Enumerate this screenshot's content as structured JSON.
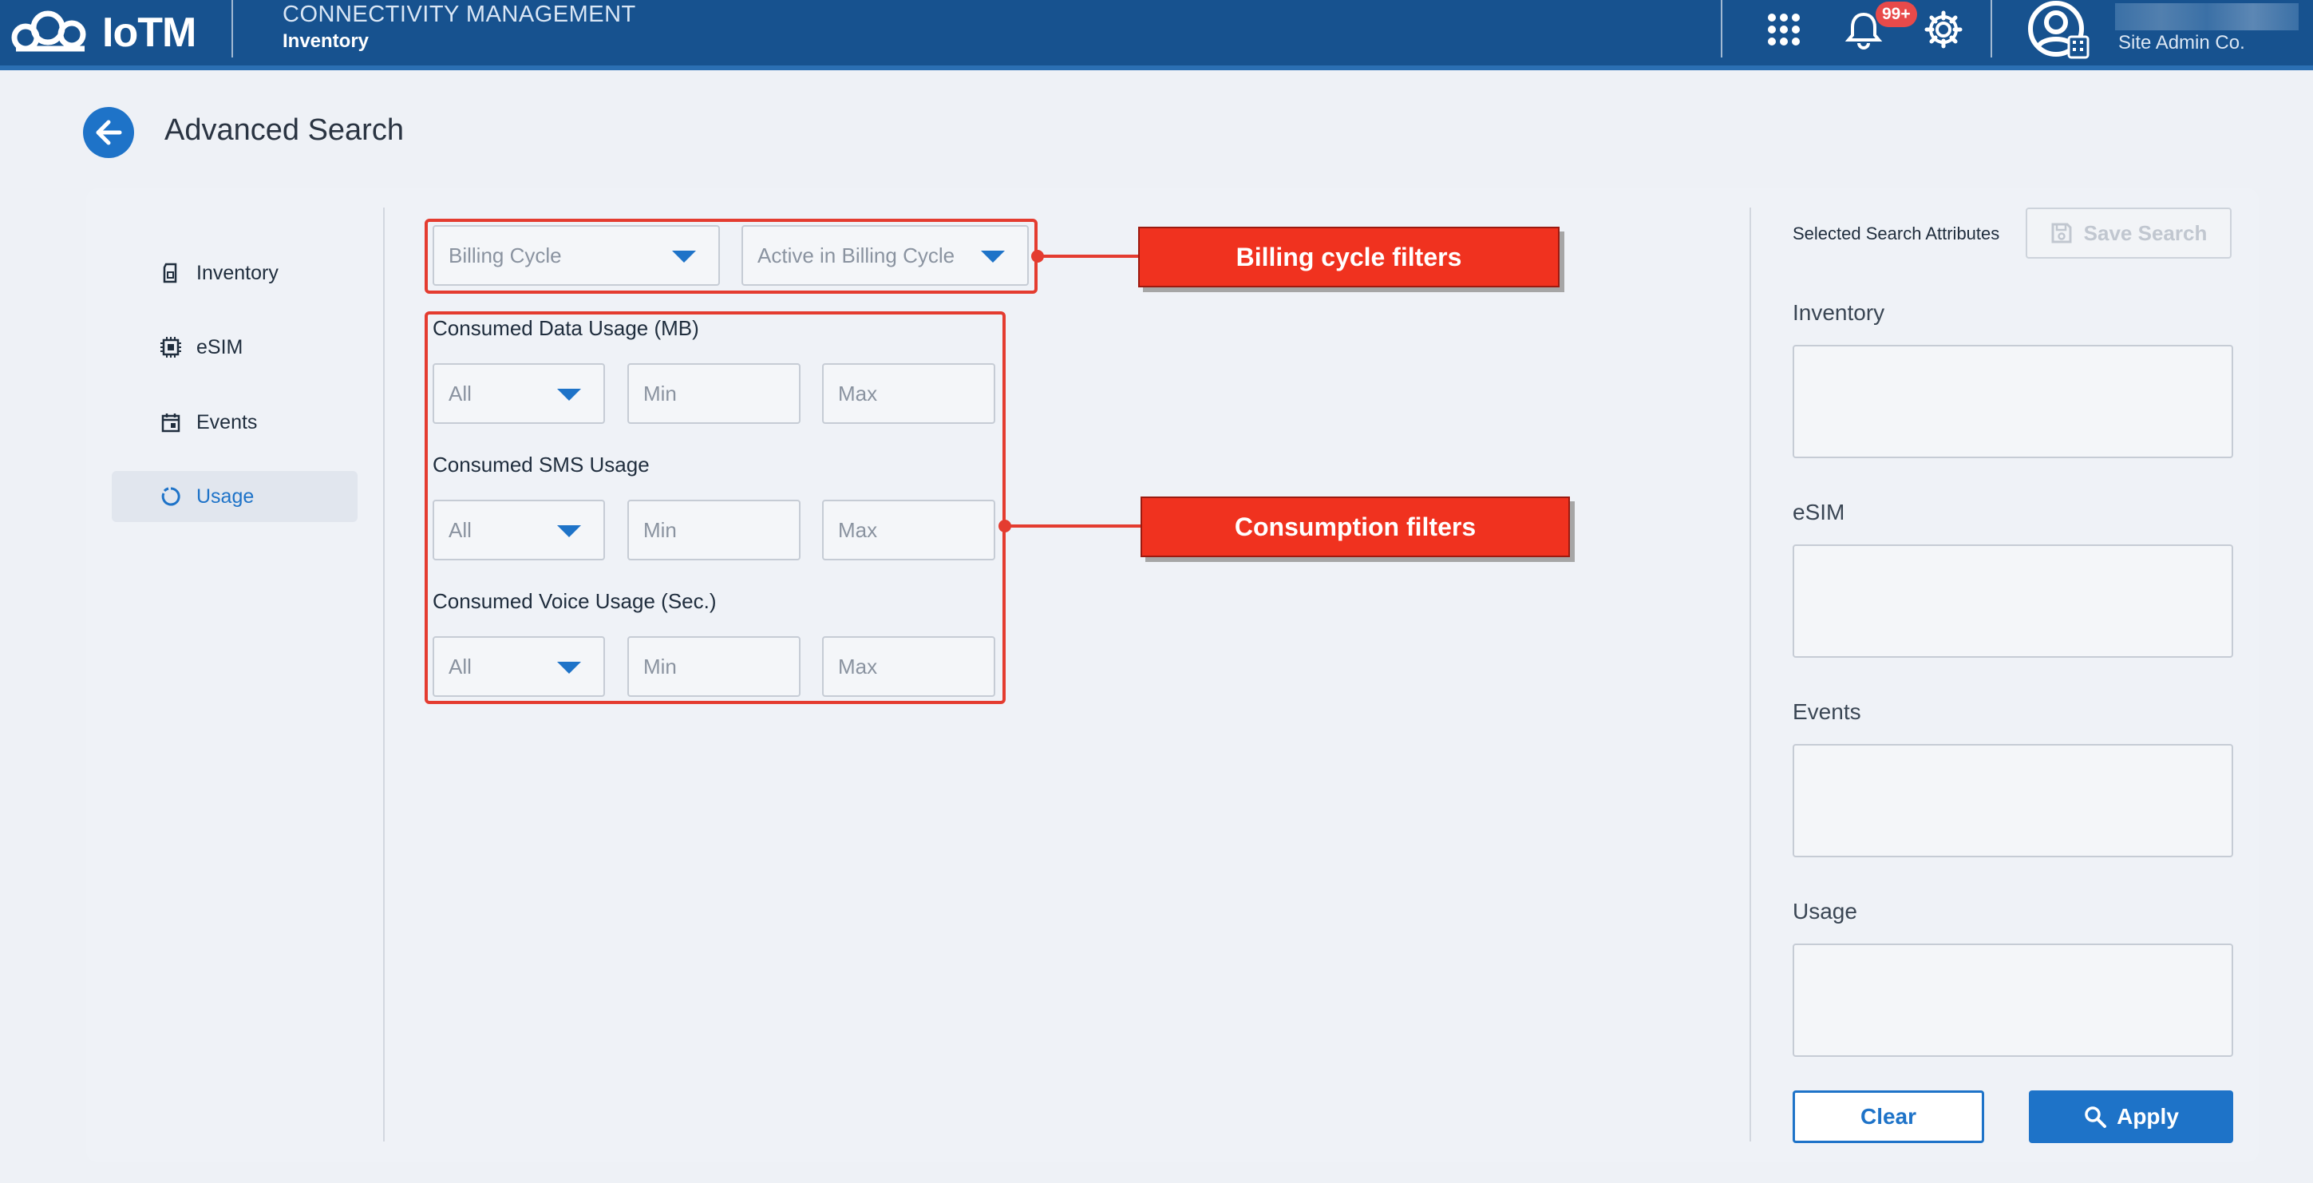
{
  "header": {
    "logo_text": "IoTM",
    "app_title": "CONNECTIVITY MANAGEMENT",
    "app_subtitle": "Inventory",
    "notification_badge": "99+",
    "user_org": "Site Admin Co.",
    "bar_color": "#17528f"
  },
  "page": {
    "title": "Advanced Search"
  },
  "sidebar": {
    "items": [
      {
        "label": "Inventory",
        "icon": "sim-card-icon",
        "active": false
      },
      {
        "label": "eSIM",
        "icon": "chip-icon",
        "active": false
      },
      {
        "label": "Events",
        "icon": "calendar-icon",
        "active": false
      },
      {
        "label": "Usage",
        "icon": "usage-ring-icon",
        "active": true
      }
    ]
  },
  "filters": {
    "billing_cycle_placeholder": "Billing Cycle",
    "active_in_billing_cycle_placeholder": "Active in Billing Cycle",
    "data_usage": {
      "label": "Consumed Data Usage (MB)",
      "select": "All",
      "min": "Min",
      "max": "Max"
    },
    "sms_usage": {
      "label": "Consumed SMS Usage",
      "select": "All",
      "min": "Min",
      "max": "Max"
    },
    "voice_usage": {
      "label": "Consumed Voice Usage (Sec.)",
      "select": "All",
      "min": "Min",
      "max": "Max"
    }
  },
  "annotations": {
    "billing": "Billing cycle filters",
    "consumption": "Consumption filters",
    "color": "#f0321f"
  },
  "right_panel": {
    "title": "Selected Search Attributes",
    "save_label": "Save Search",
    "sections": [
      "Inventory",
      "eSIM",
      "Events",
      "Usage"
    ],
    "clear_label": "Clear",
    "apply_label": "Apply"
  },
  "accent_color": "#1e73c8"
}
